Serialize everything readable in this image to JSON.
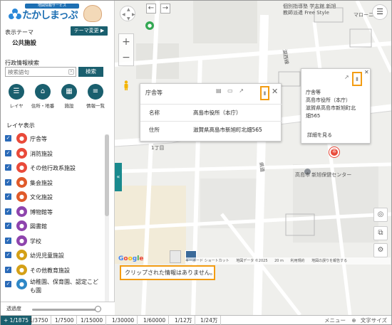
{
  "logo": {
    "tagline": "地図情報サービス",
    "name": "たかしまっぷ"
  },
  "theme": {
    "label": "表示テーマ",
    "value": "公共施設",
    "change_button": "テーマ変更 ▶"
  },
  "search": {
    "label": "行政情報検索",
    "placeholder": "検索語句",
    "button": "検索"
  },
  "tools": [
    {
      "label": "レイヤ",
      "icon": "list-icon",
      "glyph": "☰"
    },
    {
      "label": "住所・地番",
      "icon": "house-icon",
      "glyph": "⌂"
    },
    {
      "label": "施設",
      "icon": "building-icon",
      "glyph": "▦"
    },
    {
      "label": "情報一覧",
      "icon": "table-icon",
      "glyph": "≡"
    }
  ],
  "layers": {
    "title": "レイヤ表示",
    "items": [
      {
        "label": "庁舎等",
        "color": "#e94a3a"
      },
      {
        "label": "消防施設",
        "color": "#e94a3a"
      },
      {
        "label": "その他行政系施設",
        "color": "#e94a3a"
      },
      {
        "label": "集会施設",
        "color": "#e05a2a"
      },
      {
        "label": "文化施設",
        "color": "#e05a2a"
      },
      {
        "label": "博物館等",
        "color": "#8e44ad"
      },
      {
        "label": "図書館",
        "color": "#8e44ad"
      },
      {
        "label": "学校",
        "color": "#8e44ad"
      },
      {
        "label": "幼児児童施設",
        "color": "#d4a017"
      },
      {
        "label": "その他教育施設",
        "color": "#d4a017"
      },
      {
        "label": "幼稚園、保育園、認定こども園",
        "color": "#2f88c7"
      }
    ]
  },
  "opacity": {
    "label": "透過度"
  },
  "popup": {
    "title": "庁舎等",
    "rows": [
      {
        "key": "名称",
        "value": "高島市役所（本庁）"
      },
      {
        "key": "住所",
        "value": "滋賀県高島市新旭町北畑565"
      }
    ]
  },
  "popup2": {
    "line1": "庁舎等",
    "line2": "高島市役所（本庁）",
    "line3": "滋賀県高島市新旭町北",
    "line4": "畑565",
    "detail": "詳細を見る"
  },
  "map_labels": {
    "school": "個別指導塾 学志館 新旭",
    "school2": "教師派遣 Free Style",
    "store": "マローニ",
    "health": "高島市 新旭保健センター",
    "chome": "1丁目",
    "road1": "湖西線",
    "road2": "県道"
  },
  "clipboard": {
    "message": "クリップされた情報はありません。"
  },
  "attribution": {
    "shortcut": "キーボード ショートカット",
    "mapdata": "地図データ ©2025",
    "scale": "20 m",
    "terms": "利用規約",
    "report": "地図の誤りを報告する",
    "google": "Google"
  },
  "scales": [
    "+ 1/1875",
    "1/3750",
    "1/7500",
    "1/15000",
    "1/30000",
    "1/60000",
    "1/12万",
    "1/24万"
  ],
  "bottom": {
    "menu": "メニュー",
    "text_size": "文字サイズ"
  }
}
